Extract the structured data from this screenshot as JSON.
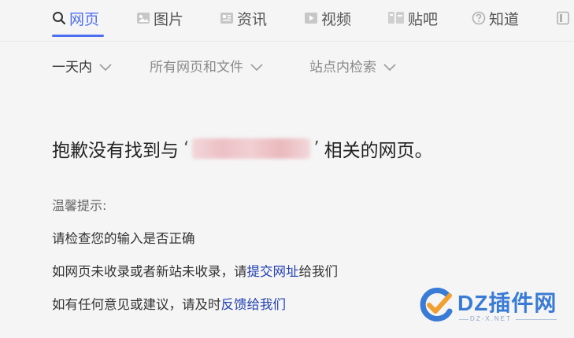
{
  "tabs": [
    {
      "label": "网页",
      "icon": "search-icon",
      "active": true
    },
    {
      "label": "图片",
      "icon": "image-icon"
    },
    {
      "label": "资讯",
      "icon": "news-icon"
    },
    {
      "label": "视频",
      "icon": "video-icon"
    },
    {
      "label": "贴吧",
      "icon": "tieba-icon"
    },
    {
      "label": "知道",
      "icon": "question-icon"
    }
  ],
  "filters": [
    {
      "label": "一天内"
    },
    {
      "label": "所有网页和文件"
    },
    {
      "label": "站点内检索"
    }
  ],
  "result": {
    "prefix": "抱歉没有找到与",
    "open_quote": "‘",
    "close_quote": "’",
    "suffix": "相关的网页。"
  },
  "tips": {
    "title": "温馨提示:",
    "line1": "请检查您的输入是否正确",
    "line2_prefix": "如网页未收录或者新站未收录，请",
    "line2_link": "提交网址",
    "line2_suffix": "给我们",
    "line3_prefix": "如有任何意见或建议，请及时",
    "line3_link": "反馈给我们"
  },
  "watermark": {
    "brand": "DZ插件网",
    "domain": "DZ-X.NET"
  },
  "colors": {
    "accent": "#4e6ef2",
    "link": "#2440b3",
    "watermark": "#3a7bd5"
  }
}
